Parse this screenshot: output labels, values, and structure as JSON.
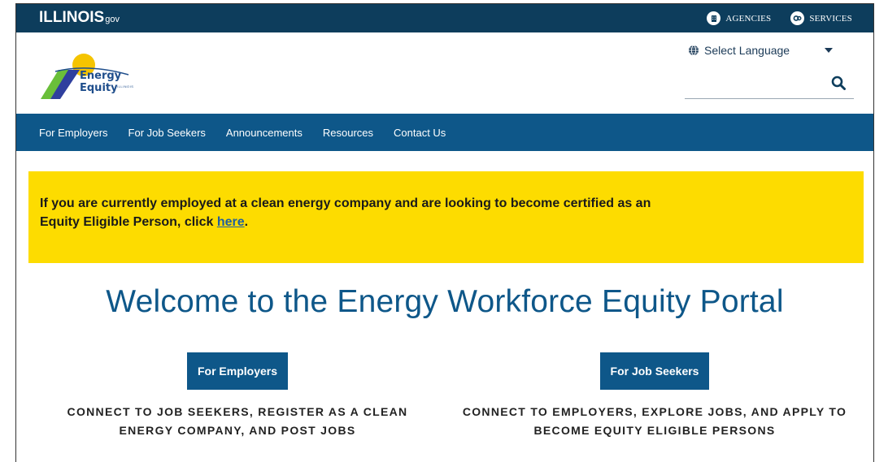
{
  "state_bar": {
    "logo_text": "ILLINOIS",
    "logo_suffix": "gov",
    "agencies_label": "AGENCIES",
    "services_label": "SERVICES",
    "bg_color": "#0d3d5c"
  },
  "header": {
    "brand_name": "Energy Equity",
    "brand_sub": "ILLINOIS",
    "language_label": "Select Language",
    "search_value": "",
    "search_placeholder": ""
  },
  "nav": {
    "items": [
      {
        "label": "For Employers"
      },
      {
        "label": "For Job Seekers"
      },
      {
        "label": "Announcements"
      },
      {
        "label": "Resources"
      },
      {
        "label": "Contact Us"
      }
    ],
    "bg_color": "#0e5789"
  },
  "alert": {
    "text": "If you are currently employed at a clean energy company and are looking to become certified as an Equity Eligible Person, click ",
    "link_text": "here",
    "tail": ".",
    "bg_color": "#fddc00"
  },
  "main": {
    "title": "Welcome to the Energy Workforce Equity Portal",
    "employers": {
      "button_label": "For Employers",
      "description": "CONNECT TO JOB SEEKERS, REGISTER AS A CLEAN ENERGY COMPANY, AND POST JOBS"
    },
    "job_seekers": {
      "button_label": "For Job Seekers",
      "description": "CONNECT TO EMPLOYERS, EXPLORE JOBS, AND APPLY TO BECOME EQUITY ELIGIBLE PERSONS"
    }
  },
  "icons": {
    "agencies": "building-icon",
    "services": "gears-icon",
    "language": "globe-icon",
    "caret": "caret-down-icon",
    "search": "search-icon"
  }
}
